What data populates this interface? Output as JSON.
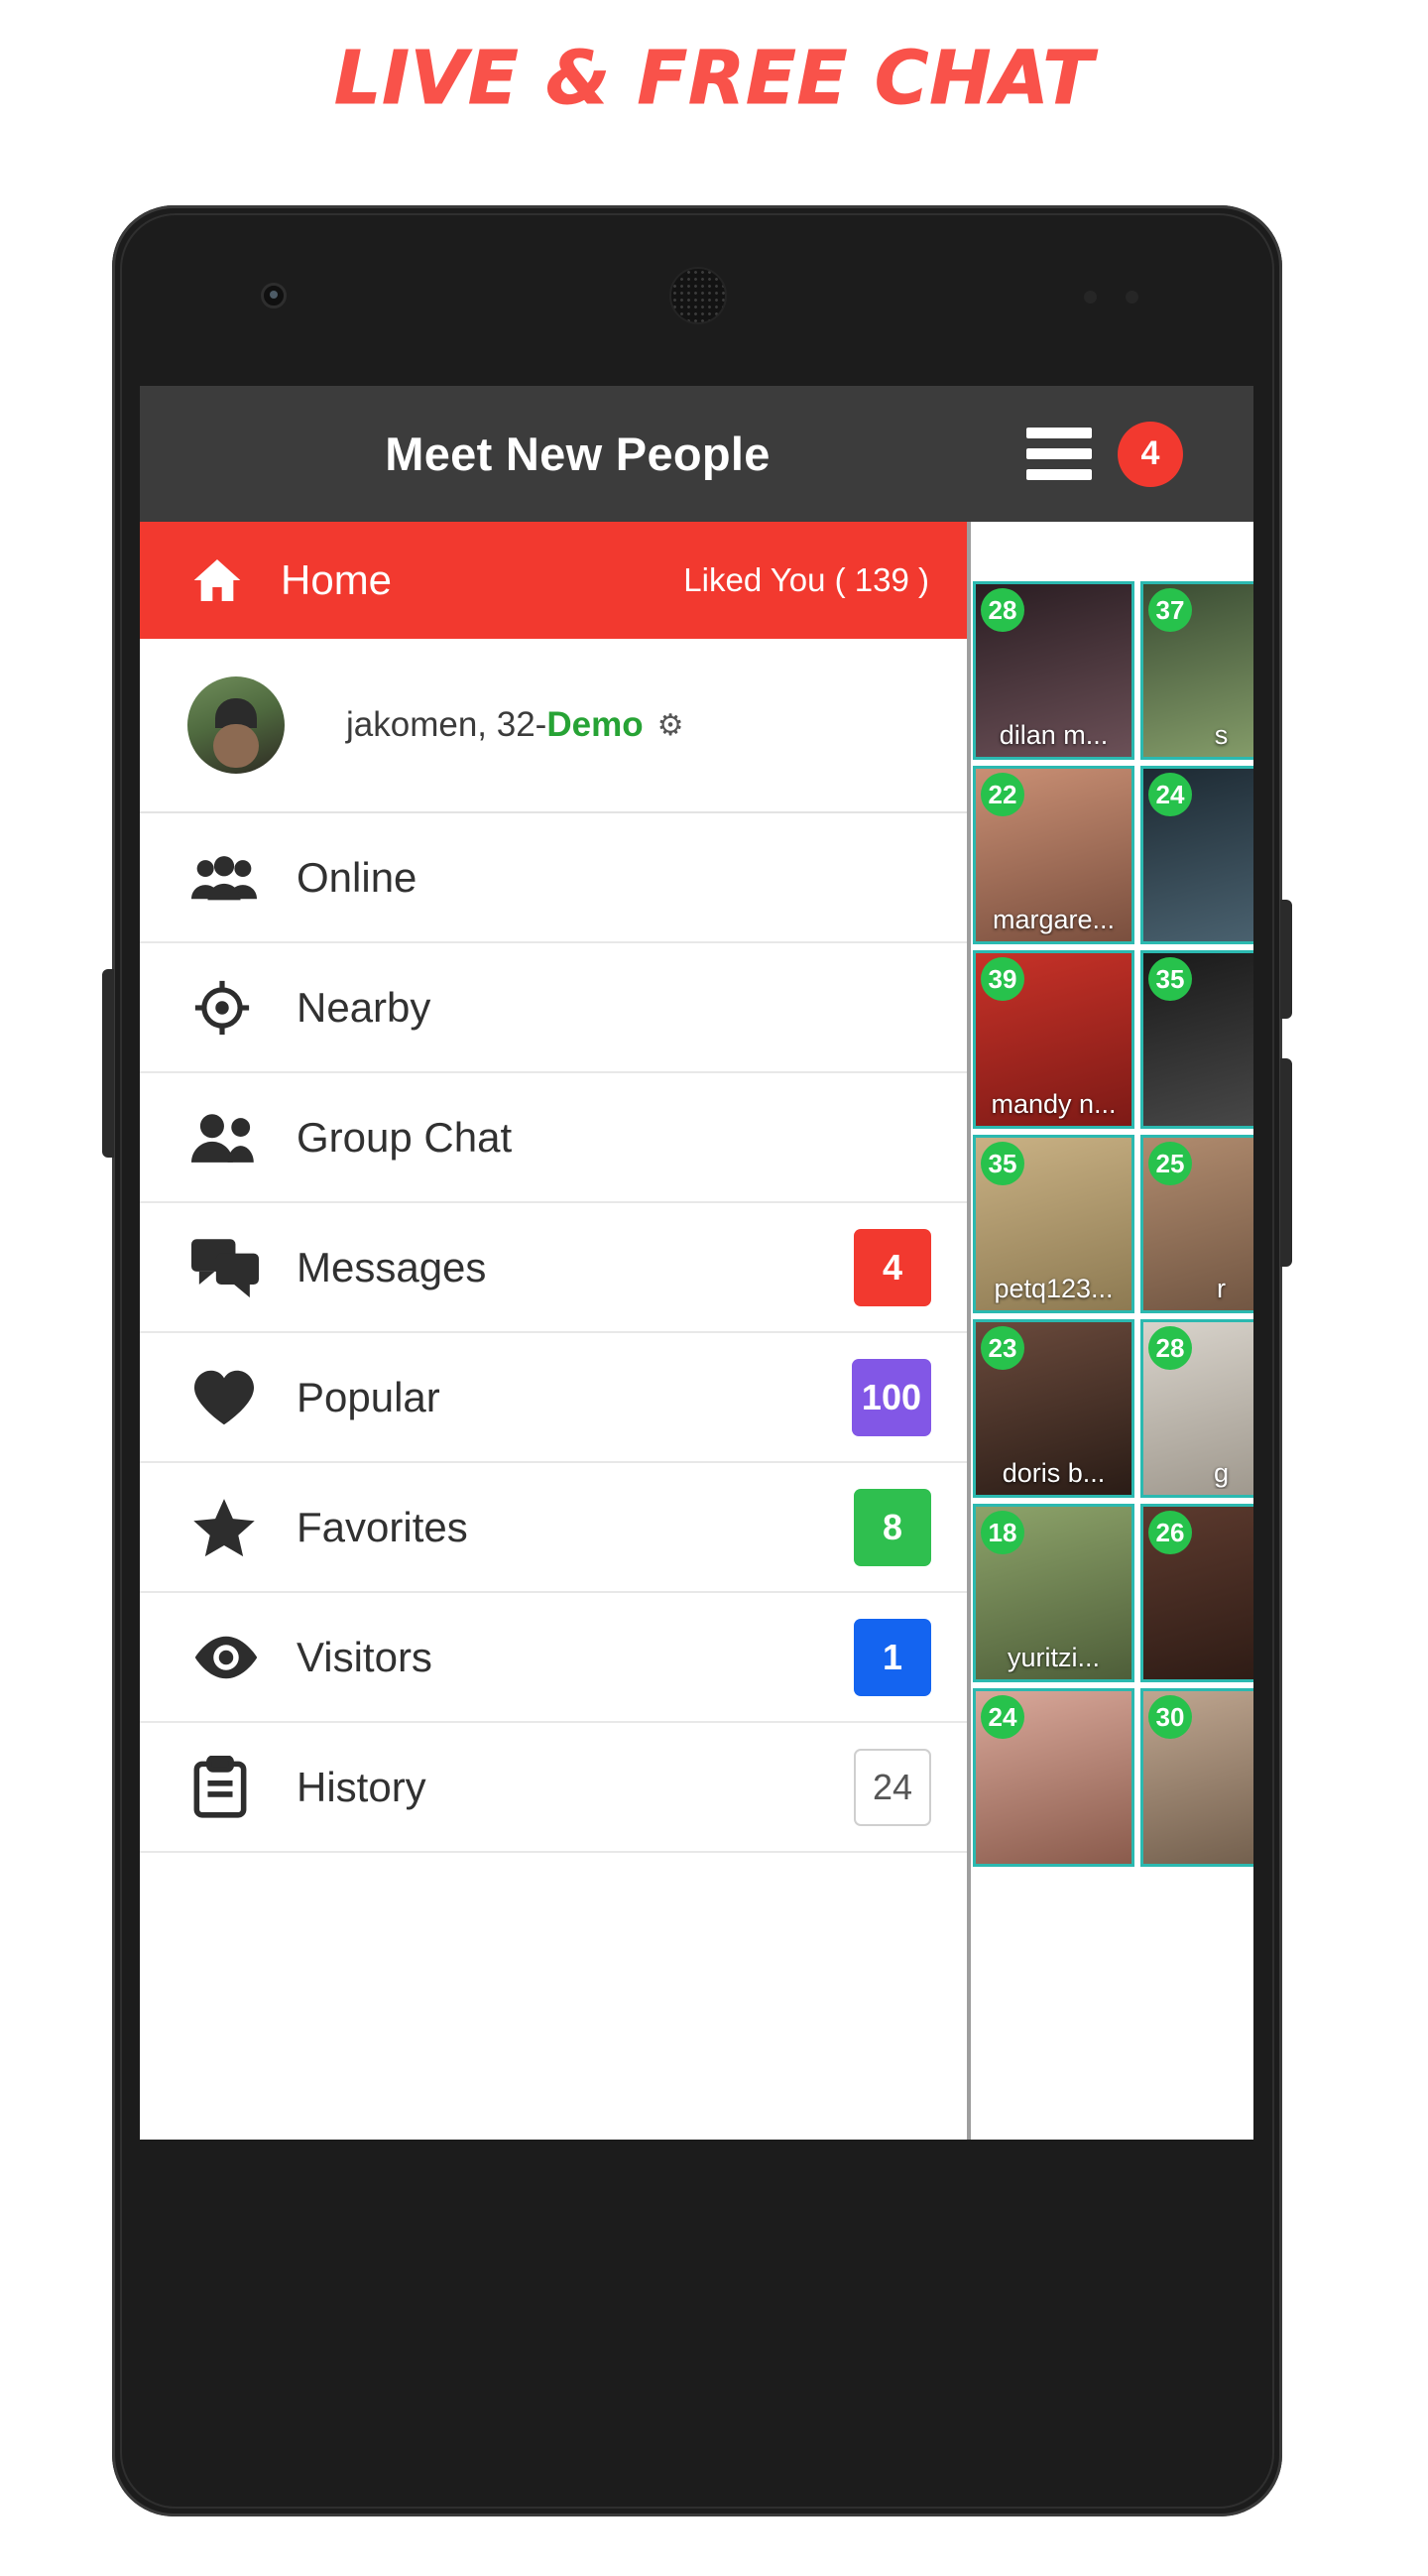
{
  "headline": "LIVE & FREE CHAT",
  "app": {
    "title": "Meet New People",
    "menu_icon": "hamburger-icon",
    "message_badge": "4"
  },
  "drawer": {
    "home": {
      "label": "Home",
      "icon": "home-icon",
      "liked_you": "Liked You ( 139 )"
    },
    "profile": {
      "name": "jakomen, 32",
      "separator": " - ",
      "demo": "Demo",
      "gear_icon": "gear-icon"
    },
    "items": [
      {
        "label": "Online",
        "icon": "people-group-icon",
        "badge": "",
        "badge_color": ""
      },
      {
        "label": "Nearby",
        "icon": "target-icon",
        "badge": "",
        "badge_color": ""
      },
      {
        "label": "Group Chat",
        "icon": "two-people-icon",
        "badge": "",
        "badge_color": ""
      },
      {
        "label": "Messages",
        "icon": "chat-bubble-icon",
        "badge": "4",
        "badge_color": "#f2392f"
      },
      {
        "label": "Popular",
        "icon": "heart-icon",
        "badge": "100",
        "badge_color": "#8257e6"
      },
      {
        "label": "Favorites",
        "icon": "star-icon",
        "badge": "8",
        "badge_color": "#2fbf4f"
      },
      {
        "label": "Visitors",
        "icon": "eye-icon",
        "badge": "1",
        "badge_color": "#1464f0"
      },
      {
        "label": "History",
        "icon": "clipboard-icon",
        "badge": "24",
        "badge_color": ""
      }
    ]
  },
  "grid": {
    "tiles": [
      {
        "age": "28",
        "name": "dilan m...",
        "c1": "#2a1d22",
        "c2": "#6b5057"
      },
      {
        "age": "37",
        "name": "s",
        "c1": "#3a4c33",
        "c2": "#88a06c"
      },
      {
        "age": "22",
        "name": "margare...",
        "c1": "#c98f74",
        "c2": "#7a4f3e"
      },
      {
        "age": "24",
        "name": "",
        "c1": "#1d2a33",
        "c2": "#4c6472"
      },
      {
        "age": "39",
        "name": "mandy n...",
        "c1": "#c73228",
        "c2": "#7d1a16"
      },
      {
        "age": "35",
        "name": "",
        "c1": "#1a1a1a",
        "c2": "#4a4a4a"
      },
      {
        "age": "35",
        "name": "petq123...",
        "c1": "#c9b184",
        "c2": "#8d7a52"
      },
      {
        "age": "25",
        "name": "r",
        "c1": "#b08b6e",
        "c2": "#6e5340"
      },
      {
        "age": "23",
        "name": "doris b...",
        "c1": "#6a4a3c",
        "c2": "#2a1c16"
      },
      {
        "age": "28",
        "name": "g",
        "c1": "#d8d3cb",
        "c2": "#9c958a"
      },
      {
        "age": "18",
        "name": "yuritzi...",
        "c1": "#8da36a",
        "c2": "#4e5e39"
      },
      {
        "age": "26",
        "name": "",
        "c1": "#5c3a2e",
        "c2": "#2c1a14"
      },
      {
        "age": "24",
        "name": "",
        "c1": "#d9a89a",
        "c2": "#8a5b4c"
      },
      {
        "age": "30",
        "name": "",
        "c1": "#bfa690",
        "c2": "#6f5c4a"
      }
    ]
  }
}
